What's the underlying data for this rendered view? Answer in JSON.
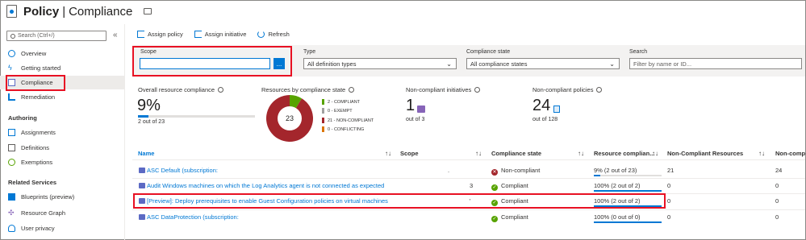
{
  "header": {
    "title": "Policy",
    "subtitle": "Compliance"
  },
  "sidebar": {
    "search_placeholder": "Search (Ctrl+/)",
    "collapse": "«",
    "items": [
      {
        "label": "Overview",
        "icon": "overview-icon"
      },
      {
        "label": "Getting started",
        "icon": "lightning-icon"
      },
      {
        "label": "Compliance",
        "icon": "compliance-icon"
      },
      {
        "label": "Remediation",
        "icon": "remediation-icon"
      }
    ],
    "authoring_title": "Authoring",
    "authoring": [
      {
        "label": "Assignments",
        "icon": "assignments-icon"
      },
      {
        "label": "Definitions",
        "icon": "definitions-icon"
      },
      {
        "label": "Exemptions",
        "icon": "exemptions-icon"
      }
    ],
    "related_title": "Related Services",
    "related": [
      {
        "label": "Blueprints (preview)",
        "icon": "blueprints-icon"
      },
      {
        "label": "Resource Graph",
        "icon": "resource-graph-icon"
      },
      {
        "label": "User privacy",
        "icon": "user-privacy-icon"
      }
    ]
  },
  "toolbar": {
    "assign_policy": "Assign policy",
    "assign_initiative": "Assign initiative",
    "refresh": "Refresh"
  },
  "filters": {
    "scope_label": "Scope",
    "scope_value": "",
    "scope_button": "...",
    "type_label": "Type",
    "type_value": "All definition types",
    "state_label": "Compliance state",
    "state_value": "All compliance states",
    "search_label": "Search",
    "search_placeholder": "Filter by name or ID..."
  },
  "summary": {
    "overall_label": "Overall resource compliance",
    "overall_value": "9%",
    "overall_fraction": 0.09,
    "overall_detail": "2 out of 23",
    "by_state_label": "Resources by compliance state",
    "donut_total": "23",
    "legend": [
      {
        "text": "2 - COMPLIANT",
        "color": "#57a300"
      },
      {
        "text": "0 - EXEMPT",
        "color": "#a0a0a0"
      },
      {
        "text": "21 - NON-COMPLIANT",
        "color": "#a4262c"
      },
      {
        "text": "0 - CONFLICTING",
        "color": "#db7500"
      }
    ],
    "donut_values": [
      2,
      0,
      21,
      0
    ],
    "initiatives_label": "Non-compliant initiatives",
    "initiatives_value": "1",
    "initiatives_detail": "out of 3",
    "policies_label": "Non-compliant policies",
    "policies_value": "24",
    "policies_detail": "out of 128"
  },
  "table": {
    "headers": {
      "name": "Name",
      "scope": "Scope",
      "state": "Compliance state",
      "resource": "Resource complian...",
      "noncompliant": "Non-Compliant Resources",
      "noncomp2": "Non-comp"
    },
    "rows": [
      {
        "name": "ASC Default (subscription:",
        "scope": ".",
        "state": "Non-compliant",
        "state_color": "#a4262c",
        "state_glyph": "✕",
        "resource": "9% (2 out of 23)",
        "fraction": 0.09,
        "noncompliant": "21",
        "noncomp2": "24"
      },
      {
        "name": "Audit Windows machines on which the Log Analytics agent is not connected as expected",
        "scope": "3",
        "state": "Compliant",
        "state_color": "#57a300",
        "state_glyph": "✓",
        "resource": "100% (2 out of 2)",
        "fraction": 1.0,
        "noncompliant": "0",
        "noncomp2": "0"
      },
      {
        "name": "[Preview]: Deploy prerequisites to enable Guest Configuration policies on virtual machines",
        "scope": "'",
        "state": "Compliant",
        "state_color": "#57a300",
        "state_glyph": "✓",
        "resource": "100% (2 out of 2)",
        "fraction": 1.0,
        "noncompliant": "0",
        "noncomp2": "0"
      },
      {
        "name": "ASC DataProtection (subscription:",
        "scope": "",
        "state": "Compliant",
        "state_color": "#57a300",
        "state_glyph": "✓",
        "resource": "100% (0 out of 0)",
        "fraction": 1.0,
        "noncompliant": "0",
        "noncomp2": "0"
      }
    ]
  },
  "colors": {
    "accent": "#0078d4",
    "highlight": "#e81123"
  }
}
